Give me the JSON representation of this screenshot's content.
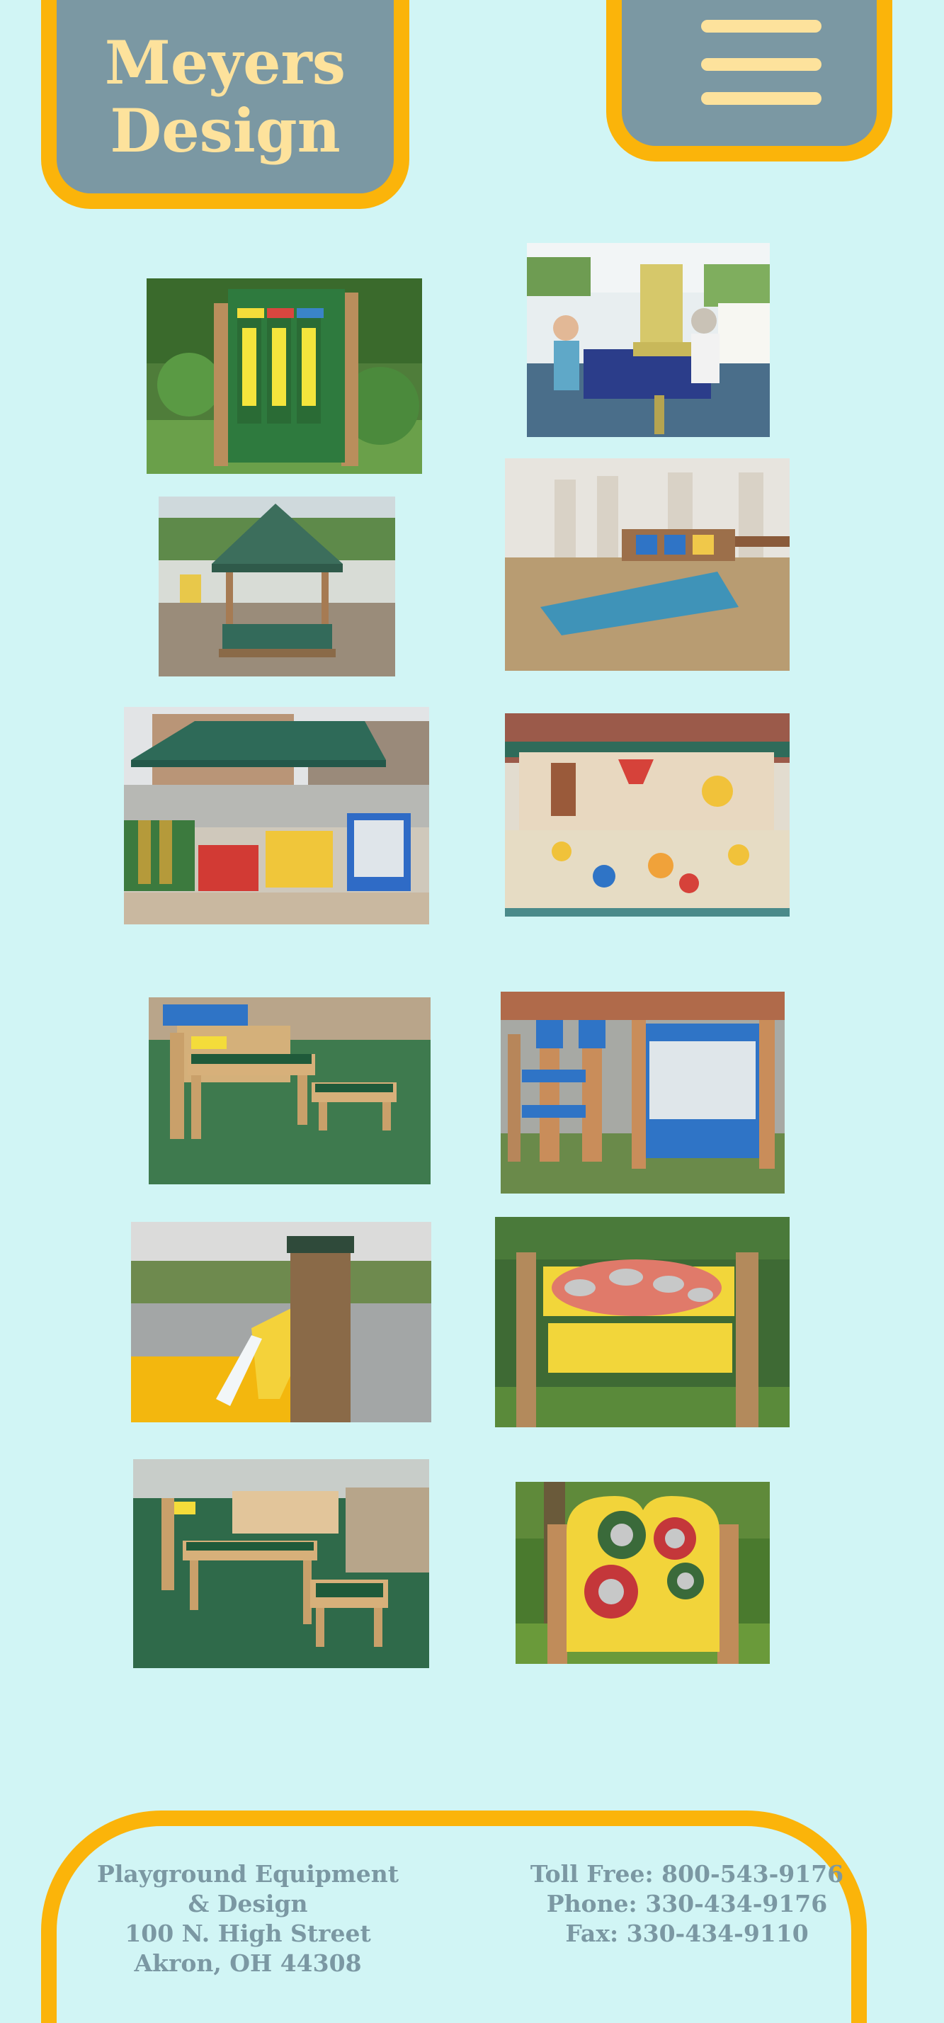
{
  "header": {
    "logo_line1": "Meyers",
    "logo_line2": "Design",
    "menu_icon": "hamburger-menu-icon"
  },
  "colors": {
    "background": "#d1f5f5",
    "accent_orange": "#fbb40a",
    "slate": "#7b98a3",
    "cream": "#fde29c"
  },
  "gallery": {
    "photos": [
      "triple-panel-play-wall",
      "children-at-sand-and-water-table",
      "gazebo-sandbox",
      "sand-digger-panel-on-platform",
      "shaded-play-panels",
      "sandbox-with-sand-toys",
      "water-trough-tables",
      "chime-and-panel-fence",
      "water-spout-chute",
      "drum-panel",
      "water-table-set",
      "gong-panel"
    ]
  },
  "footer": {
    "left": {
      "line1": "Playground Equipment & Design",
      "line2": "100 N. High Street",
      "line3": "Akron, OH 44308"
    },
    "right": {
      "line1": "Toll Free: 800-543-9176",
      "line2": "Phone: 330-434-9176",
      "line3": "Fax: 330-434-9110"
    }
  }
}
